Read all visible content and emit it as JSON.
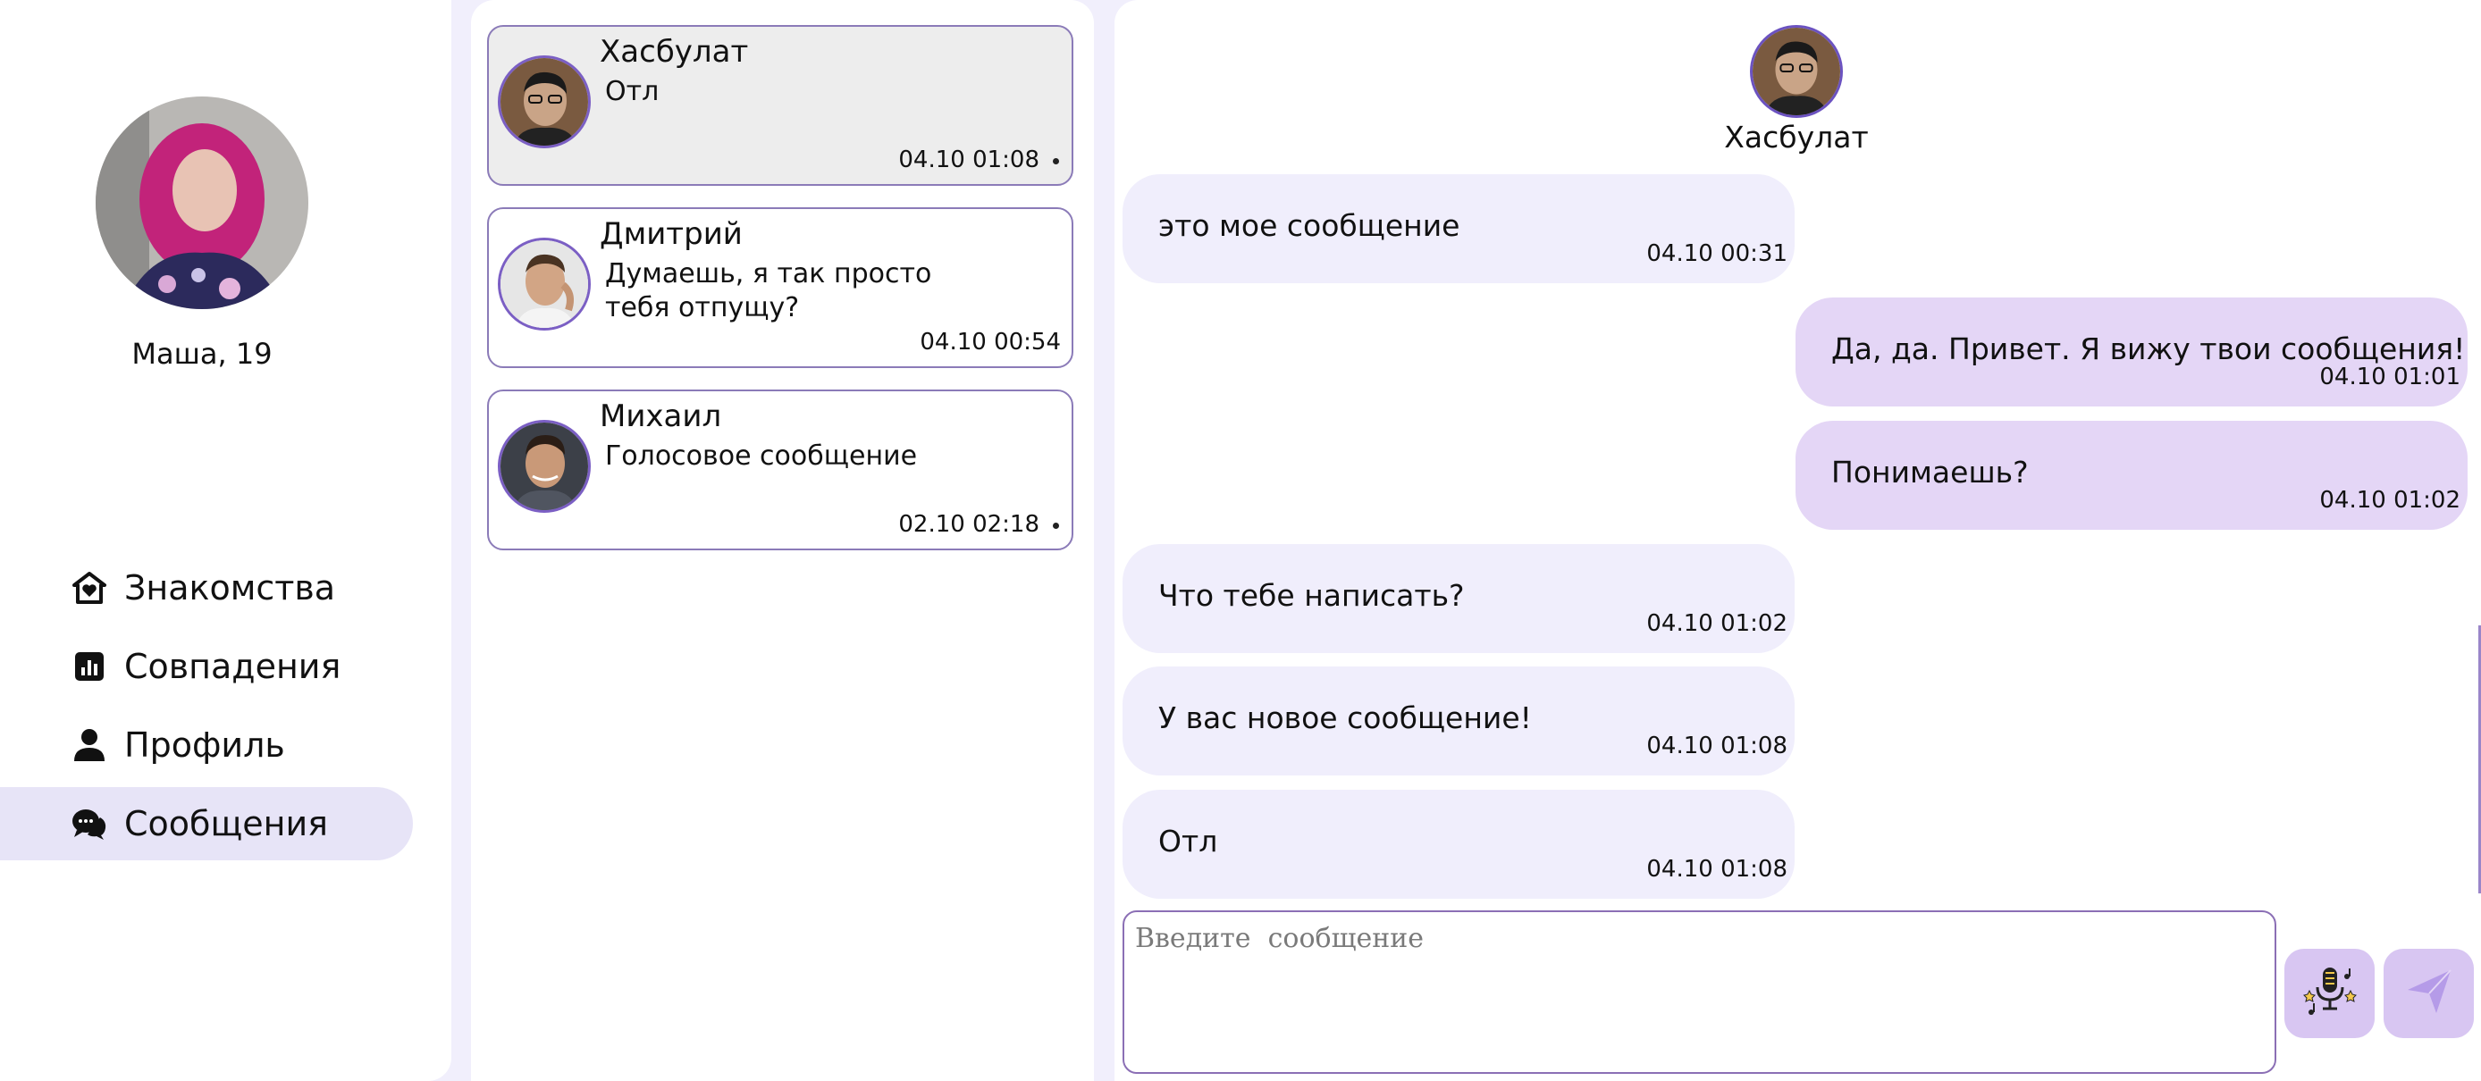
{
  "profile": {
    "name_age": "Маша, 19"
  },
  "nav": {
    "items": [
      {
        "label": "Знакомства",
        "icon": "home-heart-icon"
      },
      {
        "label": "Совпадения",
        "icon": "chart-icon"
      },
      {
        "label": "Профиль",
        "icon": "user-icon"
      },
      {
        "label": "Сообщения",
        "icon": "chat-icon",
        "active": true
      }
    ]
  },
  "chats": [
    {
      "name": "Хасбулат",
      "preview": "Отл",
      "time": "04.10 01:08",
      "unread_dot": true,
      "active": true
    },
    {
      "name": "Дмитрий",
      "preview": "Думаешь, я так просто тебя отпущу?",
      "time": "04.10 00:54",
      "unread_dot": false
    },
    {
      "name": "Михаил",
      "preview": "Голосовое сообщение",
      "time": "02.10 02:18",
      "unread_dot": true
    }
  ],
  "conversation": {
    "partner_name": "Хасбулат",
    "messages": [
      {
        "direction": "in",
        "text": "это мое сообщение",
        "time": "04.10 00:31"
      },
      {
        "direction": "out",
        "text": "Да, да. Привет. Я вижу твои сообщения!",
        "time": "04.10 01:01"
      },
      {
        "direction": "out",
        "text": "Понимаешь?",
        "time": "04.10 01:02"
      },
      {
        "direction": "in",
        "text": "Что тебе написать?",
        "time": "04.10 01:02"
      },
      {
        "direction": "in",
        "text": "У вас новое сообщение!",
        "time": "04.10 01:08"
      },
      {
        "direction": "in",
        "text": "Отл",
        "time": "04.10 01:08"
      }
    ],
    "input_placeholder": "Введите  сообщение",
    "input_value": ""
  },
  "colors": {
    "accent": "#8b6fb5",
    "incoming_bubble": "#f0eefc",
    "outgoing_bubble": "#e4d6f6",
    "page_bg": "#f1effc",
    "nav_active": "#e7e4f7"
  }
}
